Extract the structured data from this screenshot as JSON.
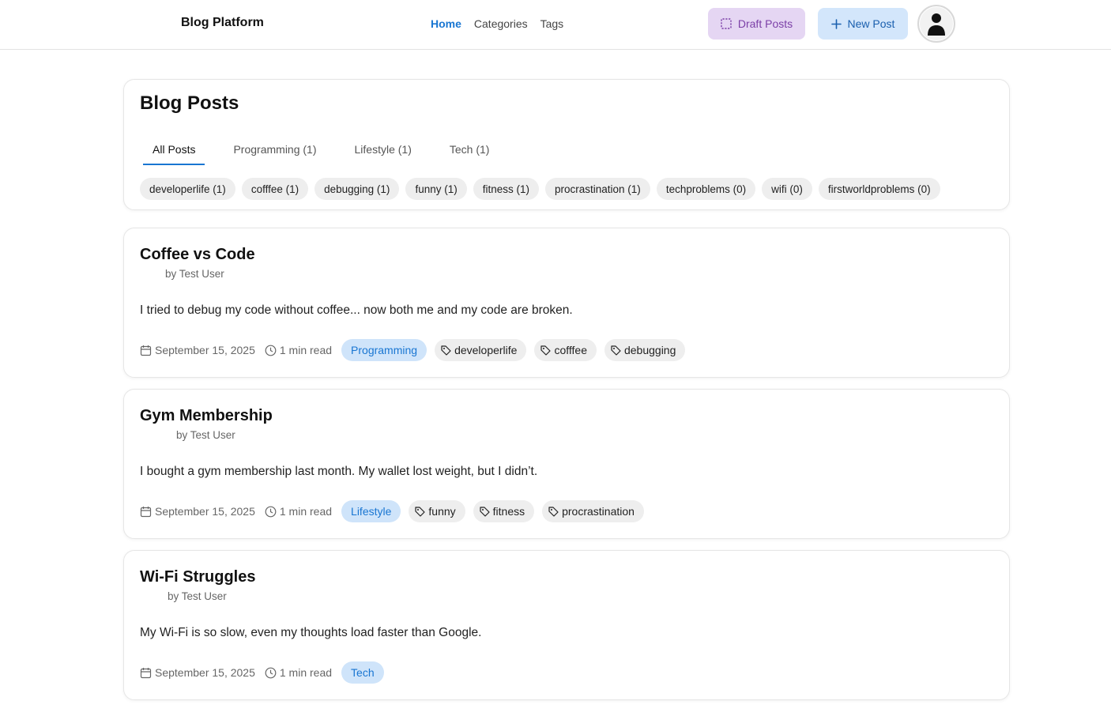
{
  "header": {
    "brand": "Blog Platform",
    "nav": [
      "Home",
      "Categories",
      "Tags"
    ],
    "active_nav": "Home",
    "draft_button": "Draft Posts",
    "new_button": "New Post"
  },
  "filters": {
    "title": "Blog Posts",
    "tabs": [
      "All Posts",
      "Programming (1)",
      "Lifestyle (1)",
      "Tech (1)"
    ],
    "active_tab": "All Posts",
    "tags": [
      "developerlife (1)",
      "cofffee (1)",
      "debugging (1)",
      "funny (1)",
      "fitness (1)",
      "procrastination (1)",
      "techproblems (0)",
      "wifi (0)",
      "firstworldproblems (0)"
    ]
  },
  "posts": [
    {
      "title": "Coffee vs Code",
      "author": "by Test User",
      "excerpt": "I tried to debug my code without coffee... now both me and my code are broken.",
      "date": "September 15, 2025",
      "read_time": "1 min read",
      "category": "Programming",
      "tags": [
        "developerlife",
        "cofffee",
        "debugging"
      ]
    },
    {
      "title": "Gym Membership",
      "author": "by Test User",
      "excerpt": "I bought a gym membership last month. My wallet lost weight, but I didn’t.",
      "date": "September 15, 2025",
      "read_time": "1 min read",
      "category": "Lifestyle",
      "tags": [
        "funny",
        "fitness",
        "procrastination"
      ]
    },
    {
      "title": "Wi-Fi Struggles",
      "author": "by Test User",
      "excerpt": "My Wi-Fi is so slow, even my thoughts load faster than Google.",
      "date": "September 15, 2025",
      "read_time": "1 min read",
      "category": "Tech",
      "tags": []
    }
  ],
  "colors": {
    "accent": "#1976d2",
    "draft_bg": "#e5d6f3",
    "new_bg": "#d3e6fb",
    "chip_bg": "#eeeeee"
  },
  "icons": {
    "draft": "dashed-square-icon",
    "new": "plus-icon",
    "avatar": "user-icon",
    "date": "calendar-icon",
    "read_time": "clock-icon",
    "tag": "tag-icon"
  }
}
